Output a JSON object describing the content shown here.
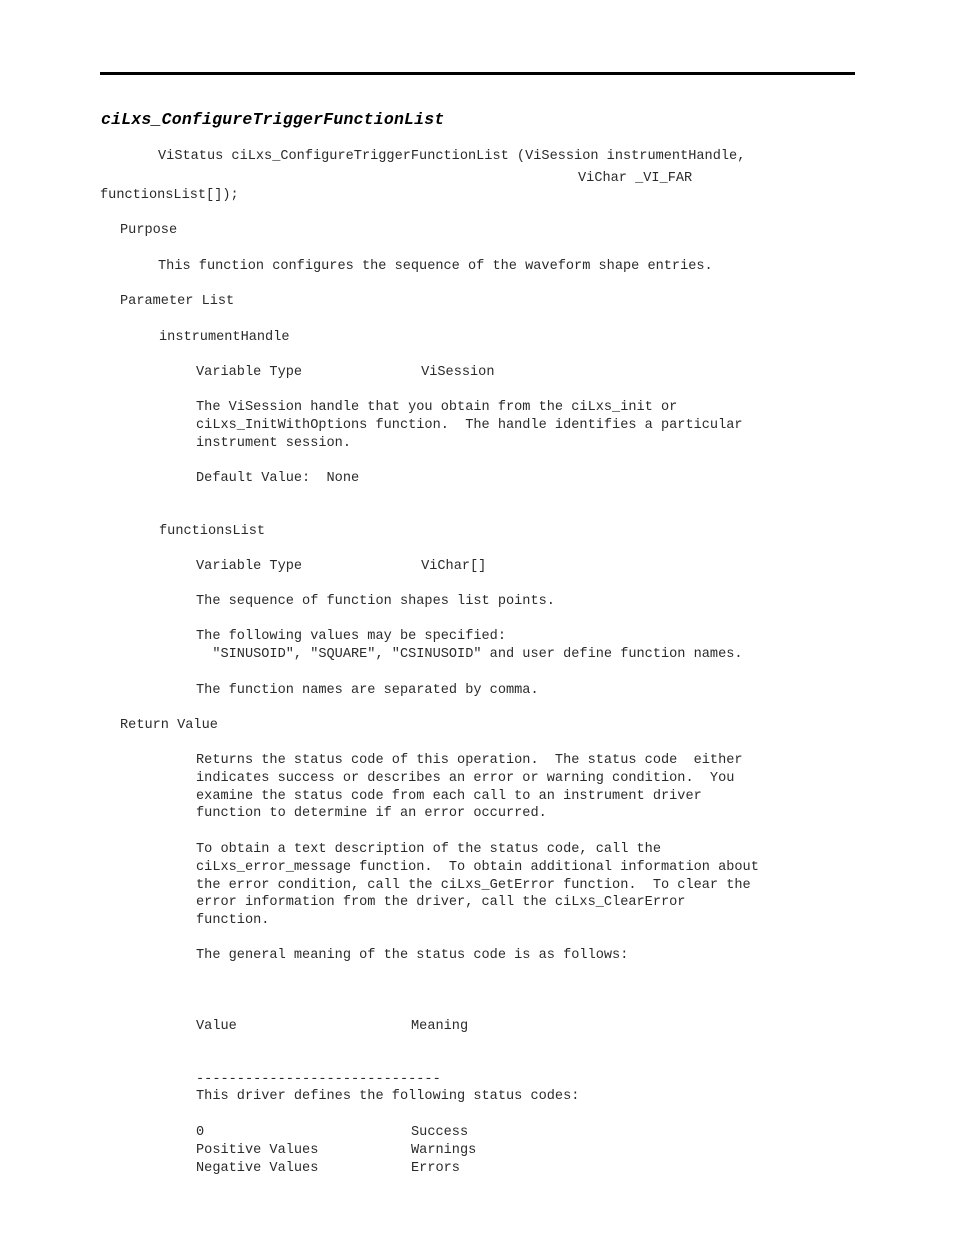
{
  "page": {
    "title": "ciLxs_ConfigureTriggerFunctionList",
    "horizontal_rule": true,
    "background_color": "#ffffff",
    "text_color": "#2a2a2a"
  },
  "signature": {
    "line1": "ViStatus ciLxs_ConfigureTriggerFunctionList (ViSession instrumentHandle,",
    "line2": "ViChar _VI_FAR",
    "line3": "functionsList[]);"
  },
  "sections": {
    "purpose": {
      "heading": "Purpose",
      "body": "This function configures the sequence of the waveform shape entries."
    },
    "parameter_list": {
      "heading": "Parameter List",
      "parameters": [
        {
          "name": "instrumentHandle",
          "variable_type_label": "Variable Type",
          "variable_type_value": "ViSession",
          "description": "The ViSession handle that you obtain from the ciLxs_init or\nciLxs_InitWithOptions function.  The handle identifies a particular\ninstrument session.",
          "default_value": "Default Value:  None"
        },
        {
          "name": "functionsList",
          "variable_type_label": "Variable Type",
          "variable_type_value": "ViChar[]",
          "description": "The sequence of function shapes list points.",
          "values_intro": "The following values may be specified:",
          "values_line": "  \"SINUSOID\", \"SQUARE\", \"CSINUSOID\" and user define function names.",
          "separator_note": "The function names are separated by comma."
        }
      ]
    },
    "return_value": {
      "heading": "Return Value",
      "paragraph1": "Returns the status code of this operation.  The status code  either\nindicates success or describes an error or warning condition.  You\nexamine the status code from each call to an instrument driver\nfunction to determine if an error occurred.",
      "paragraph2": "To obtain a text description of the status code, call the\nciLxs_error_message function.  To obtain additional information about\nthe error condition, call the ciLxs_GetError function.  To clear the\nerror information from the driver, call the ciLxs_ClearError\nfunction.",
      "paragraph3": "The general meaning of the status code is as follows:",
      "status_table": {
        "headers": [
          "Value",
          "Meaning"
        ],
        "separator": "------------------------------",
        "rows": [
          [
            "0",
            "Success"
          ],
          [
            "Positive Values",
            "Warnings"
          ],
          [
            "Negative Values",
            "Errors"
          ]
        ]
      },
      "closing": "This driver defines the following status codes:"
    }
  }
}
